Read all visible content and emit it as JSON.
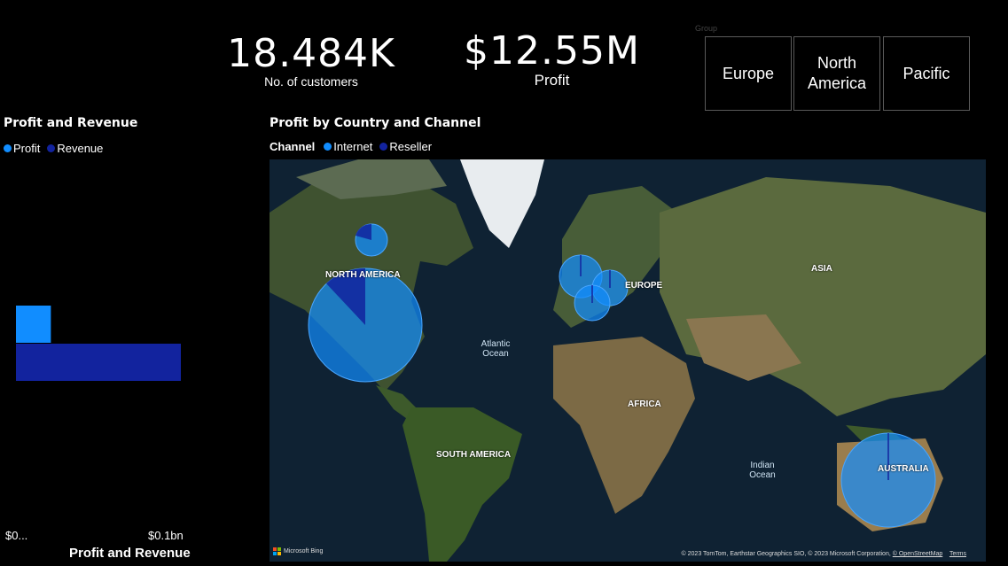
{
  "kpis": {
    "customers": {
      "value": "18.484K",
      "label": "No. of customers"
    },
    "profit": {
      "value": "$12.55M",
      "label": "Profit"
    }
  },
  "slicer": {
    "title": "Group",
    "options": [
      "Europe",
      "North America",
      "Pacific"
    ]
  },
  "bar_chart": {
    "title": "Profit and Revenue",
    "legend": [
      {
        "name": "Profit",
        "color": "#118DFF"
      },
      {
        "name": "Revenue",
        "color": "#12239E"
      }
    ],
    "ticks": [
      "$0...",
      "$0.1bn"
    ],
    "axis_title": "Profit and Revenue"
  },
  "chart_data": {
    "type": "bar",
    "orientation": "horizontal",
    "categories": [
      ""
    ],
    "series": [
      {
        "name": "Profit",
        "values": [
          0.0126
        ],
        "color": "#118DFF"
      },
      {
        "name": "Revenue",
        "values": [
          0.109
        ],
        "color": "#12239E"
      }
    ],
    "title": "Profit and Revenue",
    "xlabel": "Profit and Revenue",
    "xunits": "$bn",
    "xlim": [
      0,
      0.1
    ]
  },
  "map": {
    "title": "Profit by Country and Channel",
    "legend_title": "Channel",
    "legend": [
      {
        "name": "Internet",
        "color": "#118DFF"
      },
      {
        "name": "Reseller",
        "color": "#12239E"
      }
    ],
    "region_labels": [
      "NORTH AMERICA",
      "EUROPE",
      "ASIA",
      "AFRICA",
      "SOUTH AMERICA",
      "AUSTRALIA"
    ],
    "ocean_labels": [
      "Atlantic Ocean",
      "Indian Ocean"
    ],
    "provider": "Microsoft Bing",
    "attribution": "© 2023 TomTom, Earthstar Geographics SIO, © 2023 Microsoft Corporation,",
    "osm_link": "© OpenStreetMap",
    "terms_link": "Terms"
  }
}
